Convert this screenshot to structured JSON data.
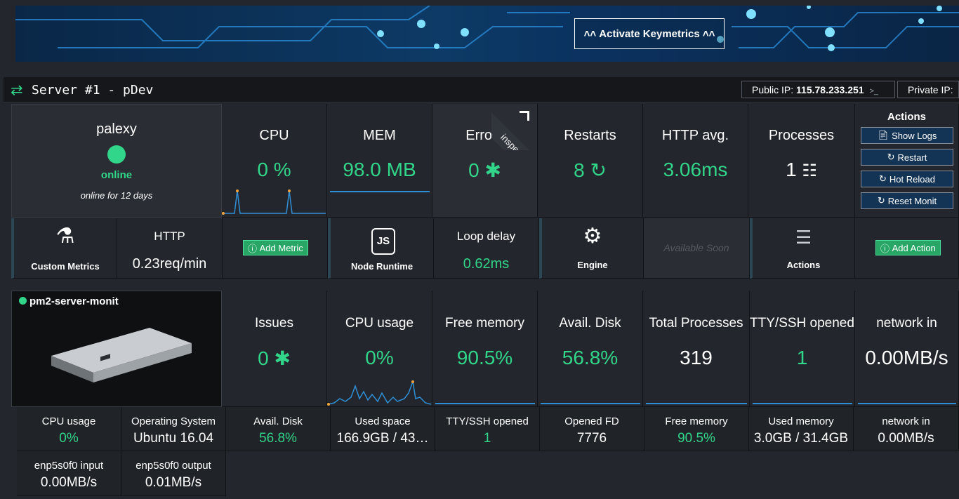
{
  "banner": {
    "button_label": "Activate Keymetrics"
  },
  "server": {
    "title": "Server #1 - pDev",
    "public_ip_label": "Public IP:",
    "public_ip": "115.78.233.251",
    "private_ip_label": "Private IP:"
  },
  "app": {
    "name": "palexy",
    "status": "online",
    "uptime": "online for 12 days",
    "cpu": {
      "label": "CPU",
      "value": "0 %"
    },
    "mem": {
      "label": "MEM",
      "value": "98.0 MB"
    },
    "errors": {
      "label": "Errors",
      "value": "0",
      "inspect": "inspect"
    },
    "restarts": {
      "label": "Restarts",
      "value": "8"
    },
    "http_avg": {
      "label": "HTTP avg.",
      "value": "3.06ms"
    },
    "processes": {
      "label": "Processes",
      "value": "1"
    },
    "actions": {
      "title": "Actions",
      "buttons": [
        "Show Logs",
        "Restart",
        "Hot Reload",
        "Reset Monit"
      ]
    }
  },
  "modules": {
    "custom_metrics": "Custom Metrics",
    "http": {
      "label": "HTTP",
      "value": "0.23req/min"
    },
    "add_metric": "Add Metric",
    "node_runtime": "Node Runtime",
    "loop_delay": {
      "label": "Loop delay",
      "value": "0.62ms"
    },
    "engine": "Engine",
    "available_soon": "Available Soon",
    "actions": "Actions",
    "add_action": "Add Action"
  },
  "server_monit": {
    "name": "pm2-server-monit",
    "tiles": [
      {
        "label": "Issues",
        "value": "0"
      },
      {
        "label": "CPU usage",
        "value": "0%"
      },
      {
        "label": "Free memory",
        "value": "90.5%"
      },
      {
        "label": "Avail. Disk",
        "value": "56.8%"
      },
      {
        "label": "Total Processes",
        "value": "319"
      },
      {
        "label": "TTY/SSH opened",
        "value": "1"
      },
      {
        "label": "network in",
        "value": "0.00MB/s"
      }
    ],
    "metrics": [
      {
        "label": "CPU usage",
        "value": "0%"
      },
      {
        "label": "Operating System",
        "value": "Ubuntu 16.04"
      },
      {
        "label": "Avail. Disk",
        "value": "56.8%"
      },
      {
        "label": "Used space",
        "value": "166.9GB / 43…"
      },
      {
        "label": "TTY/SSH opened",
        "value": "1"
      },
      {
        "label": "Opened FD",
        "value": "7776"
      },
      {
        "label": "Free memory",
        "value": "90.5%"
      },
      {
        "label": "Used memory",
        "value": "3.0GB / 31.4GB"
      },
      {
        "label": "network in",
        "value": "0.00MB/s"
      },
      {
        "label": "enp5s0f0 input",
        "value": "0.00MB/s"
      },
      {
        "label": "enp5s0f0 output",
        "value": "0.01MB/s"
      }
    ]
  },
  "colors": {
    "accent_green": "#31d68a",
    "button_blue": "#143456",
    "background": "#23262c"
  }
}
